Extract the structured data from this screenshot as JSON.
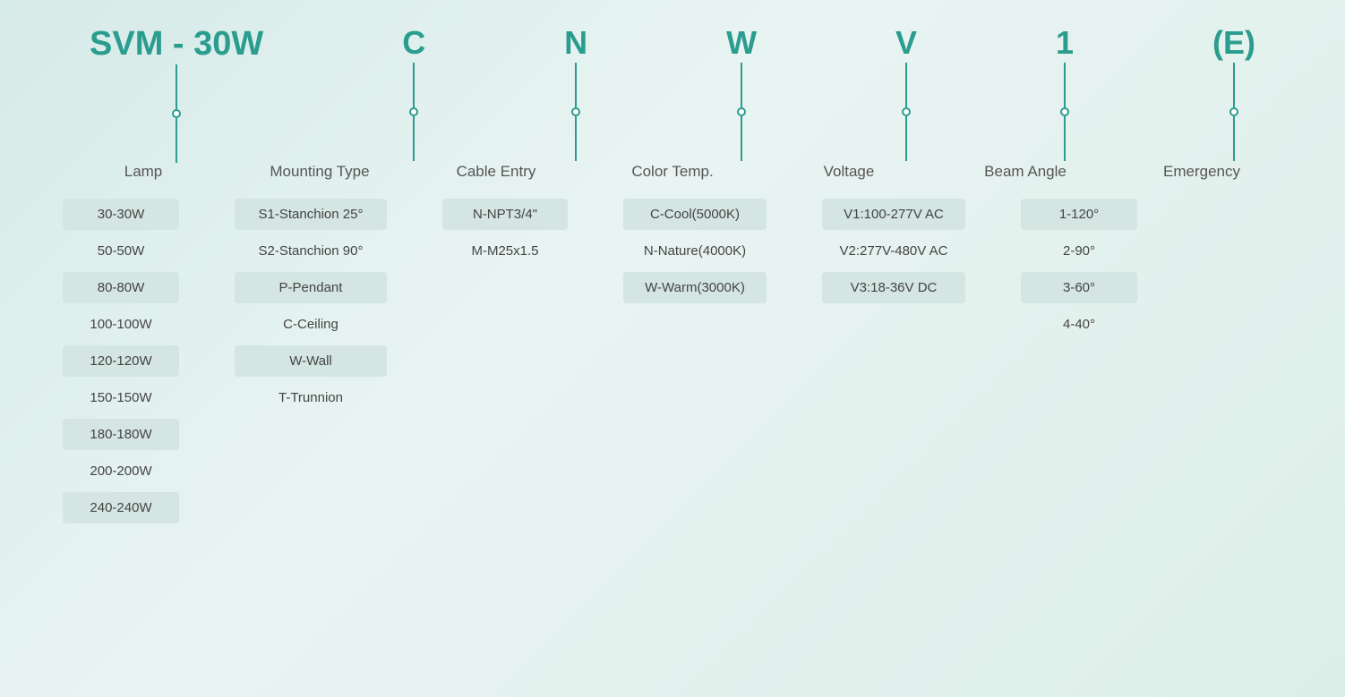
{
  "header": {
    "segments": [
      {
        "id": "lamp-code",
        "label": "SVM - 30W",
        "is_main": true
      },
      {
        "id": "mounting-code",
        "label": "C",
        "is_main": false
      },
      {
        "id": "cable-code",
        "label": "N",
        "is_main": false
      },
      {
        "id": "color-code",
        "label": "W",
        "is_main": false
      },
      {
        "id": "voltage-code",
        "label": "V",
        "is_main": false
      },
      {
        "id": "beam-code",
        "label": "1",
        "is_main": false
      },
      {
        "id": "emergency-code",
        "label": "(E)",
        "is_main": false
      }
    ]
  },
  "categories": {
    "lamp": "Lamp",
    "mounting": "Mounting Type",
    "cable": "Cable Entry",
    "color": "Color Temp.",
    "voltage": "Voltage",
    "beam": "Beam Angle",
    "emergency": "Emergency"
  },
  "options": {
    "lamp": [
      {
        "text": "30-30W",
        "shaded": true
      },
      {
        "text": "50-50W",
        "shaded": false
      },
      {
        "text": "80-80W",
        "shaded": true
      },
      {
        "text": "100-100W",
        "shaded": false
      },
      {
        "text": "120-120W",
        "shaded": true
      },
      {
        "text": "150-150W",
        "shaded": false
      },
      {
        "text": "180-180W",
        "shaded": true
      },
      {
        "text": "200-200W",
        "shaded": false
      },
      {
        "text": "240-240W",
        "shaded": true
      }
    ],
    "mounting": [
      {
        "text": "S1-Stanchion 25°",
        "shaded": true
      },
      {
        "text": "S2-Stanchion 90°",
        "shaded": false
      },
      {
        "text": "P-Pendant",
        "shaded": true
      },
      {
        "text": "C-Ceiling",
        "shaded": false
      },
      {
        "text": "W-Wall",
        "shaded": true
      },
      {
        "text": "T-Trunnion",
        "shaded": false
      }
    ],
    "cable": [
      {
        "text": "N-NPT3/4\"",
        "shaded": true
      },
      {
        "text": "M-M25x1.5",
        "shaded": false
      }
    ],
    "color": [
      {
        "text": "C-Cool(5000K)",
        "shaded": true
      },
      {
        "text": "N-Nature(4000K)",
        "shaded": false
      },
      {
        "text": "W-Warm(3000K)",
        "shaded": true
      }
    ],
    "voltage": [
      {
        "text": "V1:100-277V AC",
        "shaded": true
      },
      {
        "text": "V2:277V-480V AC",
        "shaded": false
      },
      {
        "text": "V3:18-36V DC",
        "shaded": true
      }
    ],
    "beam": [
      {
        "text": "1-120°",
        "shaded": true
      },
      {
        "text": "2-90°",
        "shaded": false
      },
      {
        "text": "3-60°",
        "shaded": true
      },
      {
        "text": "4-40°",
        "shaded": false
      }
    ],
    "emergency": []
  }
}
